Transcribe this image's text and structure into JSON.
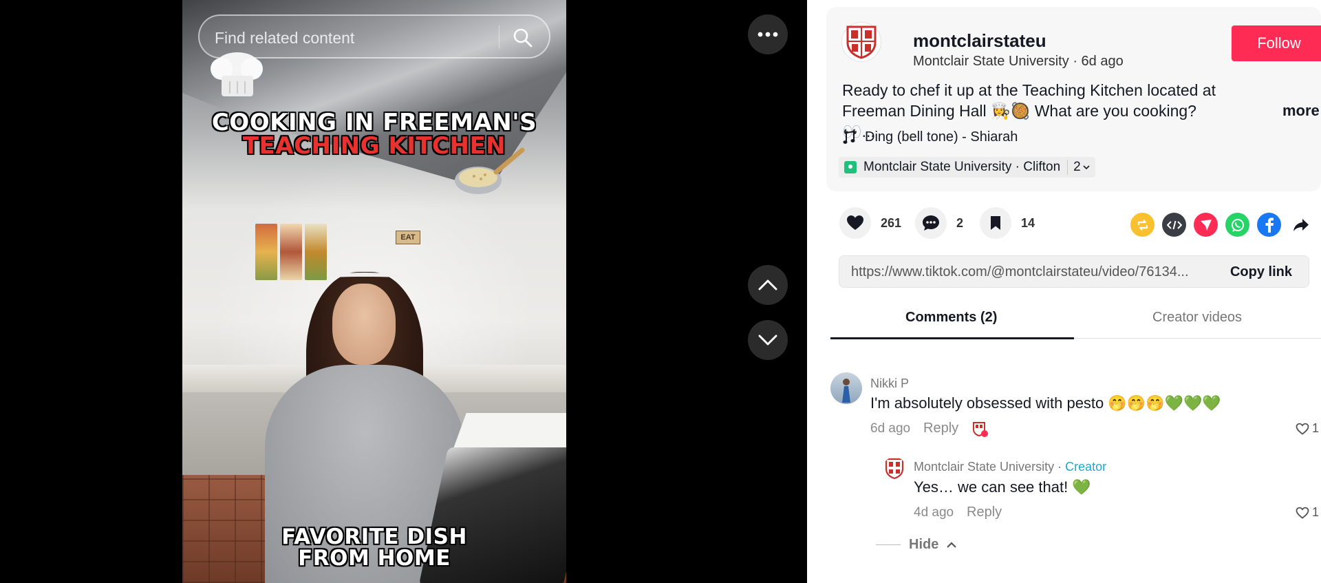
{
  "video": {
    "search_placeholder": "Find related content",
    "overlay_title_line1": "COOKING IN FREEMAN'S",
    "overlay_title_line2": "TEACHING KITCHEN",
    "overlay_caption_line1": "FAVORITE DISH",
    "overlay_caption_line2": "FROM HOME",
    "sign_text": "EAT"
  },
  "post": {
    "username": "montclairstateu",
    "display_name": "Montclair State University",
    "time_ago": "6d ago",
    "follow_label": "Follow",
    "description": "Ready to chef it up at the Teaching Kitchen located at Freeman Dining Hall 👩‍🍳🥘 What are you cooking? 👀...",
    "more_label": "more",
    "music": "Ding (bell tone) - Shiarah",
    "location": "Montclair State University · Clifton",
    "location_extra": "2"
  },
  "stats": {
    "likes": "261",
    "comments": "2",
    "bookmarks": "14"
  },
  "link": {
    "url": "https://www.tiktok.com/@montclairstateu/video/76134...",
    "copy_label": "Copy link"
  },
  "tabs": {
    "comments": "Comments (2)",
    "creator_videos": "Creator videos"
  },
  "comments": [
    {
      "name": "Nikki P",
      "text": "I'm absolutely obsessed with pesto 🤭🤭🤭💚💚💚",
      "time": "6d ago",
      "reply_label": "Reply",
      "likes": "1"
    },
    {
      "name": "Montclair State University",
      "creator_label": "Creator",
      "text": "Yes… we can see that! 💚",
      "time": "4d ago",
      "reply_label": "Reply",
      "likes": "1"
    }
  ],
  "hide_label": "Hide",
  "colors": {
    "follow": "#fe2c55",
    "creator_tag": "#20a9c4",
    "title_red": "#e8322f"
  }
}
